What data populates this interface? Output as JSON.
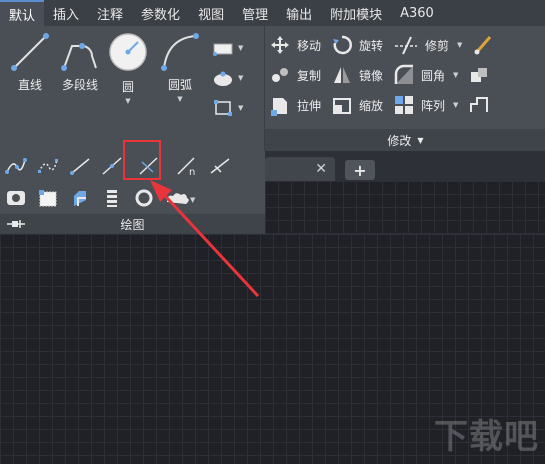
{
  "ribbon_tabs": [
    "默认",
    "插入",
    "注释",
    "参数化",
    "视图",
    "管理",
    "输出",
    "附加模块",
    "A360"
  ],
  "draw_tools": {
    "line": "直线",
    "polyline": "多段线",
    "circle": "圆",
    "arc": "圆弧"
  },
  "modify_tools": {
    "move": "移动",
    "rotate": "旋转",
    "trim": "修剪",
    "copy": "复制",
    "mirror": "镜像",
    "fillet": "圆角",
    "stretch": "拉伸",
    "scale": "缩放",
    "array": "阵列"
  },
  "panels": {
    "modify_title": "修改",
    "draw_title": "绘图"
  },
  "file_tabs": {
    "close_glyph": "✕",
    "add_glyph": "+"
  },
  "watermark": "下载吧",
  "colors": {
    "highlight": "#e8343a",
    "accent_blue": "#5a8fd0"
  }
}
